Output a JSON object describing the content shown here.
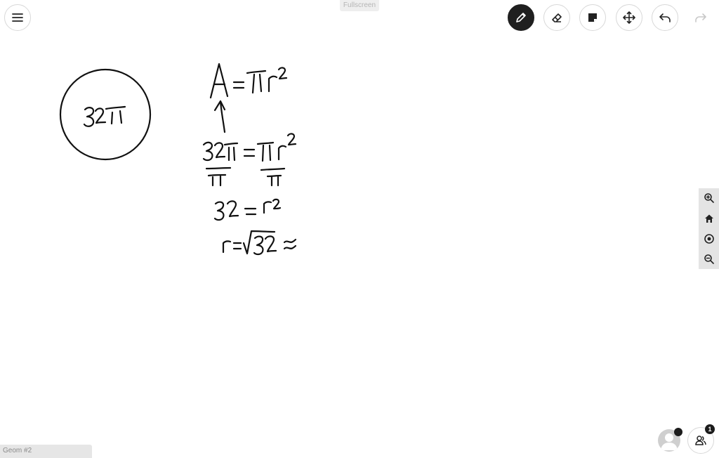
{
  "window": {
    "fullscreen_label": "Fullscreen"
  },
  "toolbar": {
    "tools": [
      {
        "name": "pen-tool-button",
        "icon": "pencil-icon",
        "active": true
      },
      {
        "name": "eraser-tool-button",
        "icon": "eraser-icon",
        "active": false
      },
      {
        "name": "sticky-note-button",
        "icon": "sticky-note-icon",
        "active": false
      },
      {
        "name": "move-tool-button",
        "icon": "move-arrows-icon",
        "active": false
      },
      {
        "name": "undo-button",
        "icon": "undo-icon",
        "active": false
      },
      {
        "name": "redo-button",
        "icon": "redo-icon",
        "active": false,
        "disabled": true
      }
    ]
  },
  "zoom_controls": [
    "zoom-in-icon",
    "home-icon",
    "target-icon",
    "zoom-out-icon"
  ],
  "board": {
    "label": "Geom #2"
  },
  "users": {
    "count": "1"
  },
  "canvas": {
    "circle_label": "32π",
    "equations": [
      "A = πr²",
      "32π / π = πr² / π",
      "32 = r²",
      "r = √32 ≈"
    ]
  },
  "colors": {
    "active_tool": "#1f1f1f",
    "ink": "#111111",
    "panel": "#e4e4e4"
  }
}
